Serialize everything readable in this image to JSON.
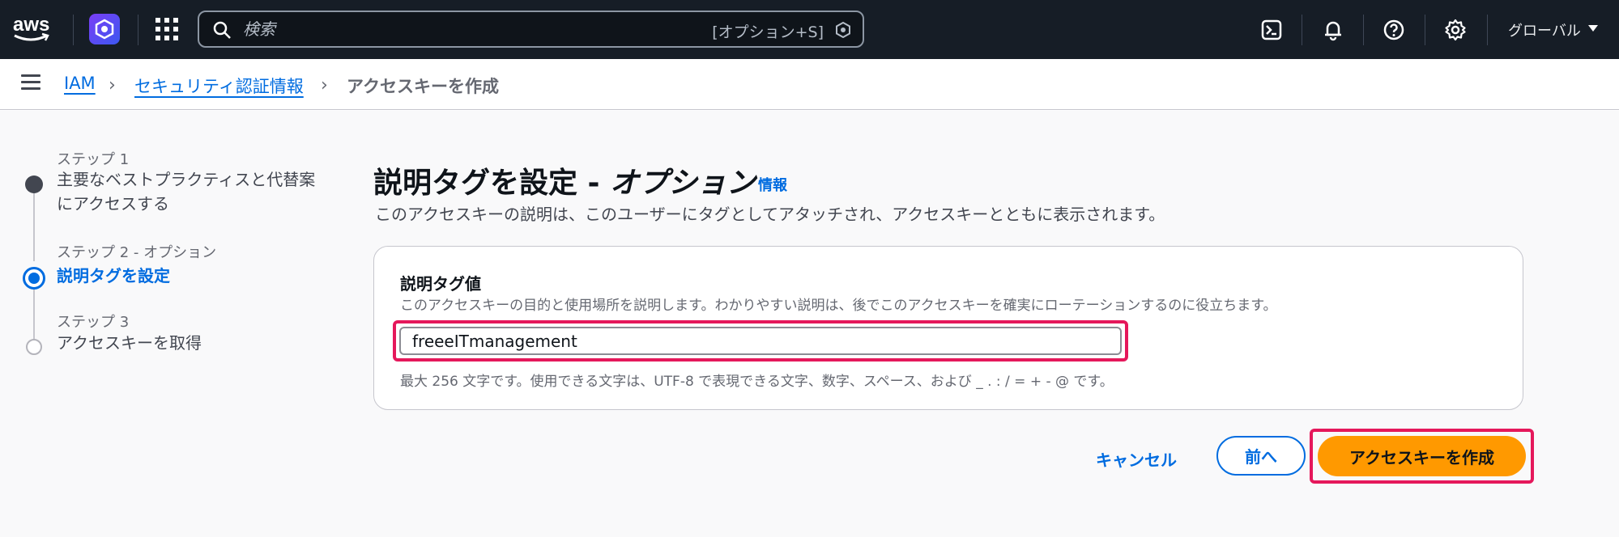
{
  "topbar": {
    "logo_text": "aws",
    "search_placeholder": "検索",
    "search_shortcut": "[オプション+S]",
    "region": "グローバル",
    "icons": [
      "cloudshell-icon",
      "bell-icon",
      "help-icon",
      "gear-icon"
    ],
    "colors": {
      "bg": "#161d26",
      "service_icon": "#5b4cf2"
    }
  },
  "breadcrumb": {
    "items": [
      "IAM",
      "セキュリティ認証情報",
      "アクセスキーを作成"
    ]
  },
  "steps": [
    {
      "num": "ステップ 1",
      "title": "主要なベストプラクティスと代替案にアクセスする",
      "title_line1": "主要なベストプラクティスと代替案",
      "title_line2": "にアクセスする",
      "state": "completed"
    },
    {
      "num": "ステップ 2 - オプション",
      "title": "説明タグを設定",
      "state": "active"
    },
    {
      "num": "ステップ 3",
      "title": "アクセスキーを取得",
      "state": "pending"
    }
  ],
  "main": {
    "heading": "説明タグを設定 - ",
    "heading_italic": "オプション",
    "info_link": "情報",
    "description": "このアクセスキーの説明は、このユーザーにタグとしてアタッチされ、アクセスキーとともに表示されます。"
  },
  "form": {
    "label": "説明タグ値",
    "help": "このアクセスキーの目的と使用場所を説明します。わかりやすい説明は、後でこのアクセスキーを確実にローテーションするのに役立ちます。",
    "value": "freeeITmanagement",
    "constraint": "最大 256 文字です。使用できる文字は、UTF-8 で表現できる文字、数字、スペース、および _ . : / = + - @ です。"
  },
  "actions": {
    "cancel": "キャンセル",
    "previous": "前へ",
    "create": "アクセスキーを作成",
    "colors": {
      "primary": "#ff9900",
      "link": "#006ce0",
      "highlight": "#e5185b"
    }
  }
}
